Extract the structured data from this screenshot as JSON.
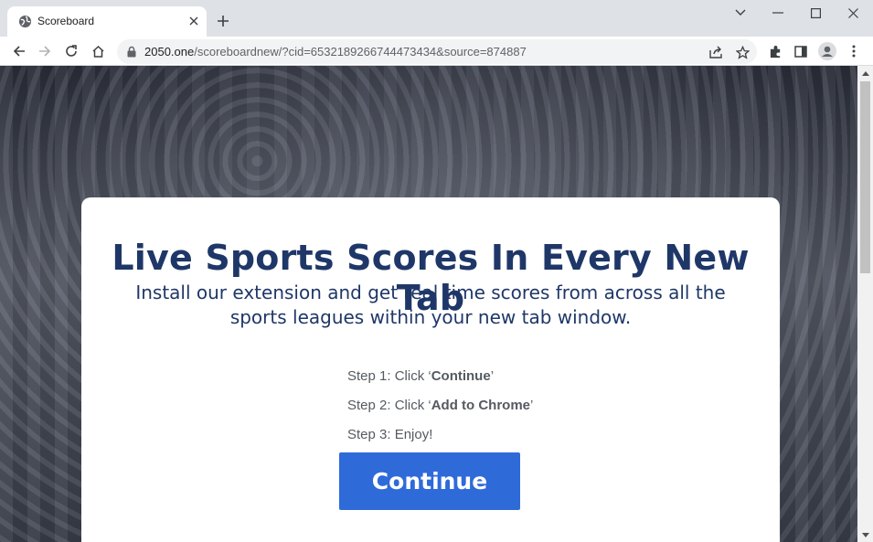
{
  "browser": {
    "tab": {
      "title": "Scoreboard",
      "favicon": "globe-icon"
    },
    "address": {
      "host": "2050.one",
      "path": "/scoreboardnew/?cid=6532189266744473434&source=874887"
    }
  },
  "page": {
    "headline": "Live Sports Scores In Every New Tab",
    "subline": "Install our extension and get real time scores from across all the sports leagues within your new tab window.",
    "steps": [
      {
        "prefix": "Step 1: Click ‘",
        "bold": "Continue",
        "suffix": "’"
      },
      {
        "prefix": "Step 2: Click ‘",
        "bold": "Add to Chrome",
        "suffix": "’"
      },
      {
        "prefix": "Step 3: Enjoy!",
        "bold": "",
        "suffix": ""
      }
    ],
    "continue_label": "Continue"
  },
  "colors": {
    "headline": "#1f3768",
    "button": "#2f6ad9"
  }
}
